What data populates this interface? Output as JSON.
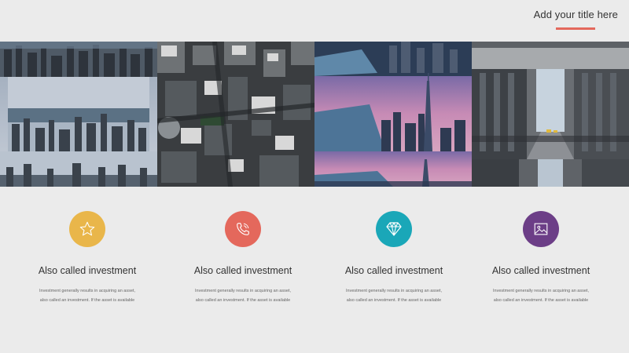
{
  "slide": {
    "title": "Add your title here",
    "colors": {
      "background": "#ebebeb",
      "accent_line": "#e4685c"
    }
  },
  "photos": [
    {
      "subject": "foggy harbor skyline"
    },
    {
      "subject": "aerial city rooftops"
    },
    {
      "subject": "tower skyline at dusk"
    },
    {
      "subject": "city street avenue"
    }
  ],
  "features": [
    {
      "icon": "star-icon",
      "color": "#e9b64a",
      "heading": "Also called investment",
      "line1": "Investment generally results in acquiring an asset,",
      "line2": "also called an investment. If the asset is available"
    },
    {
      "icon": "phone-icon",
      "color": "#e4685c",
      "heading": "Also called investment",
      "line1": "Investment generally results in acquiring an asset,",
      "line2": "also called an investment. If the asset is available"
    },
    {
      "icon": "diamond-icon",
      "color": "#1aa7b8",
      "heading": "Also called investment",
      "line1": "Investment generally results in acquiring an asset,",
      "line2": "also called an investment. If the asset is available"
    },
    {
      "icon": "image-icon",
      "color": "#6c3e87",
      "heading": "Also called investment",
      "line1": "Investment generally results in acquiring an asset,",
      "line2": "also called an investment. If the asset is available"
    }
  ]
}
